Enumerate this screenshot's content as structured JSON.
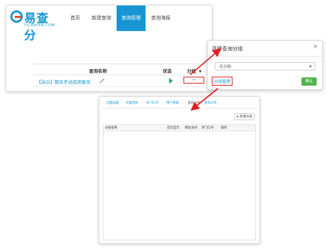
{
  "brand": {
    "name": "易查分",
    "domain": "YICHAFEN.COM"
  },
  "nav": {
    "items": [
      "首页",
      "新建查询",
      "查询管理",
      "查询海报"
    ],
    "active_index": 2
  },
  "query_table": {
    "headers": [
      "查询名称",
      "状态",
      "分组"
    ],
    "sort_indicator": "▼",
    "rows": [
      {
        "name": "【演示】期末考试成绩查询",
        "status": "play-icon",
        "group": "—"
      }
    ]
  },
  "dialog": {
    "title": "选择查询分组",
    "close_symbol": "×",
    "select_value": "-无分组-",
    "manage_link": "分组管理",
    "confirm_label": "确认"
  },
  "group_panel": {
    "tabs": [
      "页面设置",
      "页面风格",
      "补门口令",
      "用户管理",
      "查询分组",
      "查询工作"
    ],
    "active_tab_index": 4,
    "add_button": "新增分组",
    "columns": [
      "分组名称",
      "首页显示",
      "网址访问",
      "开门口令",
      "操作"
    ]
  },
  "colors": {
    "brand_blue": "#1796d3",
    "highlight_red": "#e02020",
    "confirm_green": "#52b34a",
    "play_green": "#3aa66a"
  }
}
